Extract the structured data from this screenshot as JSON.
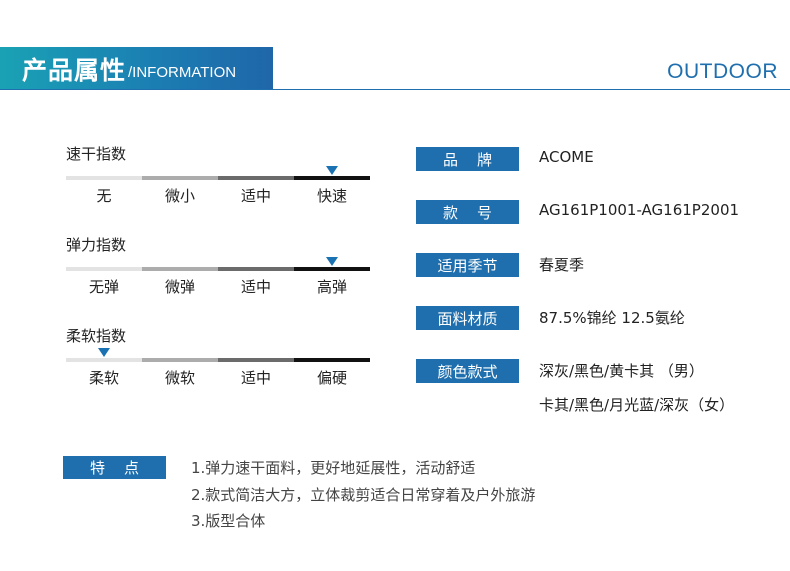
{
  "header": {
    "title_cn": "产品属性",
    "title_en": "/INFORMATION",
    "brand_right": "OUTDOOR",
    "colors": {
      "accent": "#1f6fae",
      "gradient_start": "#1aa2b4"
    }
  },
  "indices": [
    {
      "title": "速干指数",
      "levels": [
        "无",
        "微小",
        "适中",
        "快速"
      ],
      "selected_index": 3
    },
    {
      "title": "弹力指数",
      "levels": [
        "无弹",
        "微弹",
        "适中",
        "高弹"
      ],
      "selected_index": 3
    },
    {
      "title": "柔软指数",
      "levels": [
        "柔软",
        "微软",
        "适中",
        "偏硬"
      ],
      "selected_index": 0
    }
  ],
  "attributes": [
    {
      "label": "品    牌",
      "value": "ACOME"
    },
    {
      "label": "款    号",
      "value": "AG161P1001-AG161P2001"
    },
    {
      "label": "适用季节",
      "value": "春夏季"
    },
    {
      "label": "面料材质",
      "value": "87.5%锦纶 12.5氨纶"
    },
    {
      "label": "颜色款式",
      "value": "深灰/黑色/黄卡其 （男）",
      "value2": "卡其/黑色/月光蓝/深灰（女）"
    }
  ],
  "features": {
    "label": "特    点",
    "items": [
      "1.弹力速干面料，更好地延展性，活动舒适",
      "2.款式简洁大方，立体裁剪适合日常穿着及户外旅游",
      "3.版型合体"
    ]
  }
}
